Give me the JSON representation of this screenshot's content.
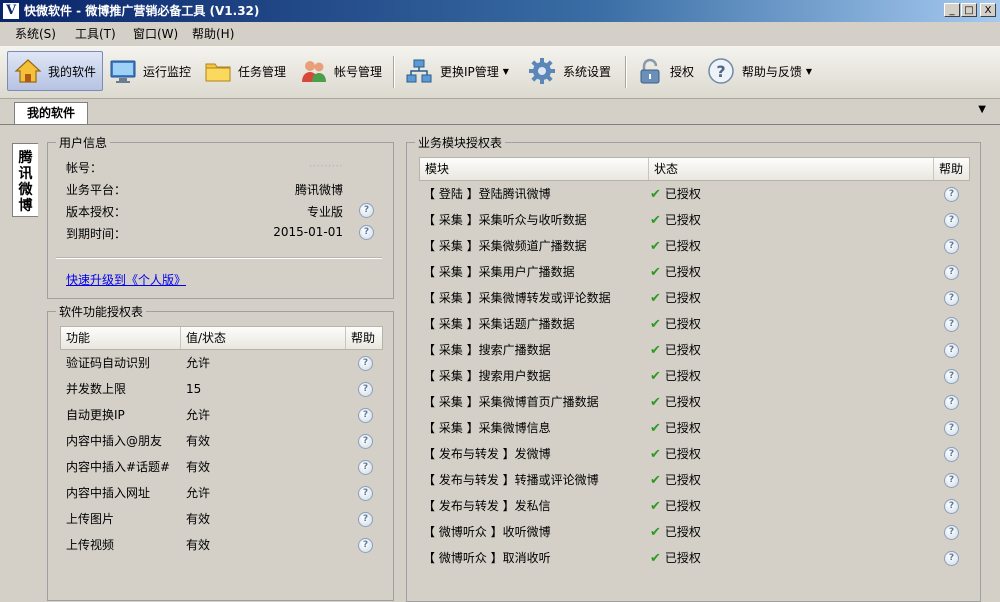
{
  "window": {
    "title": "快微软件 - 微博推广营销必备工具 (V1.32)",
    "app_icon_letter": "V",
    "controls": [
      "_",
      "□",
      "X"
    ]
  },
  "menubar": [
    "系统(S)",
    "工具(T)",
    "窗口(W)",
    "帮助(H)"
  ],
  "toolbar": {
    "my_software": "我的软件",
    "run_monitor": "运行监控",
    "task_manage": "任务管理",
    "account_manage": "帐号管理",
    "change_ip": "更换IP管理",
    "settings": "系统设置",
    "authorize": "授权",
    "help_feedback": "帮助与反馈"
  },
  "tab": {
    "label": "我的软件"
  },
  "side_tab": {
    "label": "腾讯微博"
  },
  "user_info": {
    "title": "用户信息",
    "rows": [
      {
        "label": "帐号：",
        "value": "·········",
        "help": false
      },
      {
        "label": "业务平台：",
        "value": "腾讯微博",
        "help": false
      },
      {
        "label": "版本授权：",
        "value": "专业版",
        "help": true
      },
      {
        "label": "到期时间：",
        "value": "2015-01-01",
        "help": true
      }
    ],
    "upgrade_link": "快速升级到《个人版》"
  },
  "features": {
    "title": "软件功能授权表",
    "headers": [
      "功能",
      "值/状态",
      "帮助"
    ],
    "rows": [
      {
        "name": "验证码自动识别",
        "value": "允许"
      },
      {
        "name": "并发数上限",
        "value": "15"
      },
      {
        "name": "自动更换IP",
        "value": "允许"
      },
      {
        "name": "内容中插入@朋友",
        "value": "有效"
      },
      {
        "name": "内容中插入#话题#",
        "value": "有效"
      },
      {
        "name": "内容中插入网址",
        "value": "允许"
      },
      {
        "name": "上传图片",
        "value": "有效"
      },
      {
        "name": "上传视频",
        "value": "有效"
      }
    ]
  },
  "modules": {
    "title": "业务模块授权表",
    "headers": [
      "模块",
      "状态",
      "帮助"
    ],
    "rows": [
      {
        "name": "【 登陆 】登陆腾讯微博",
        "status": "已授权"
      },
      {
        "name": "【 采集 】采集听众与收听数据",
        "status": "已授权"
      },
      {
        "name": "【 采集 】采集微频道广播数据",
        "status": "已授权"
      },
      {
        "name": "【 采集 】采集用户广播数据",
        "status": "已授权"
      },
      {
        "name": "【 采集 】采集微博转发或评论数据",
        "status": "已授权"
      },
      {
        "name": "【 采集 】采集话题广播数据",
        "status": "已授权"
      },
      {
        "name": "【 采集 】搜索广播数据",
        "status": "已授权"
      },
      {
        "name": "【 采集 】搜索用户数据",
        "status": "已授权"
      },
      {
        "name": "【 采集 】采集微博首页广播数据",
        "status": "已授权"
      },
      {
        "name": "【 采集 】采集微博信息",
        "status": "已授权"
      },
      {
        "name": "【 发布与转发 】发微博",
        "status": "已授权"
      },
      {
        "name": "【 发布与转发 】转播或评论微博",
        "status": "已授权"
      },
      {
        "name": "【 发布与转发 】发私信",
        "status": "已授权"
      },
      {
        "name": "【 微博听众 】收听微博",
        "status": "已授权"
      },
      {
        "name": "【 微博听众 】取消收听",
        "status": "已授权"
      }
    ]
  },
  "icons": {
    "help": "?",
    "check": "✔",
    "dropdown": "▼"
  }
}
